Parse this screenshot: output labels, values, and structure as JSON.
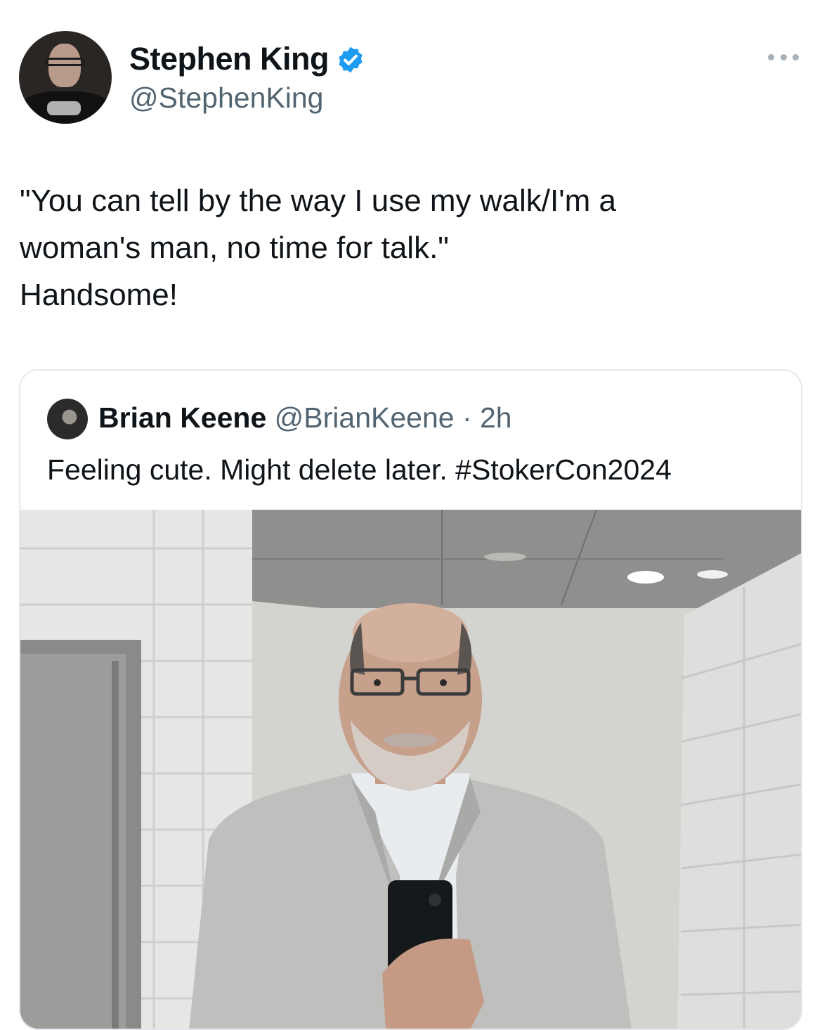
{
  "author": {
    "name": "Stephen King",
    "handle": "@StephenKing"
  },
  "tweet": {
    "lines": [
      "\"You can tell by the way I use my walk/I'm a",
      "woman's man, no time for talk.\"",
      "Handsome!"
    ]
  },
  "quote": {
    "name": "Brian Keene",
    "handle": "@BrianKeene",
    "separator": " · ",
    "time": "2h",
    "text": "Feeling cute. Might delete later. #StokerCon2024"
  },
  "colors": {
    "verified": "#1d9bf0",
    "secondary_text": "#536471",
    "primary_text": "#0f1419"
  },
  "icons": {
    "verified": "verified-badge-icon",
    "more": "more-options-icon"
  }
}
